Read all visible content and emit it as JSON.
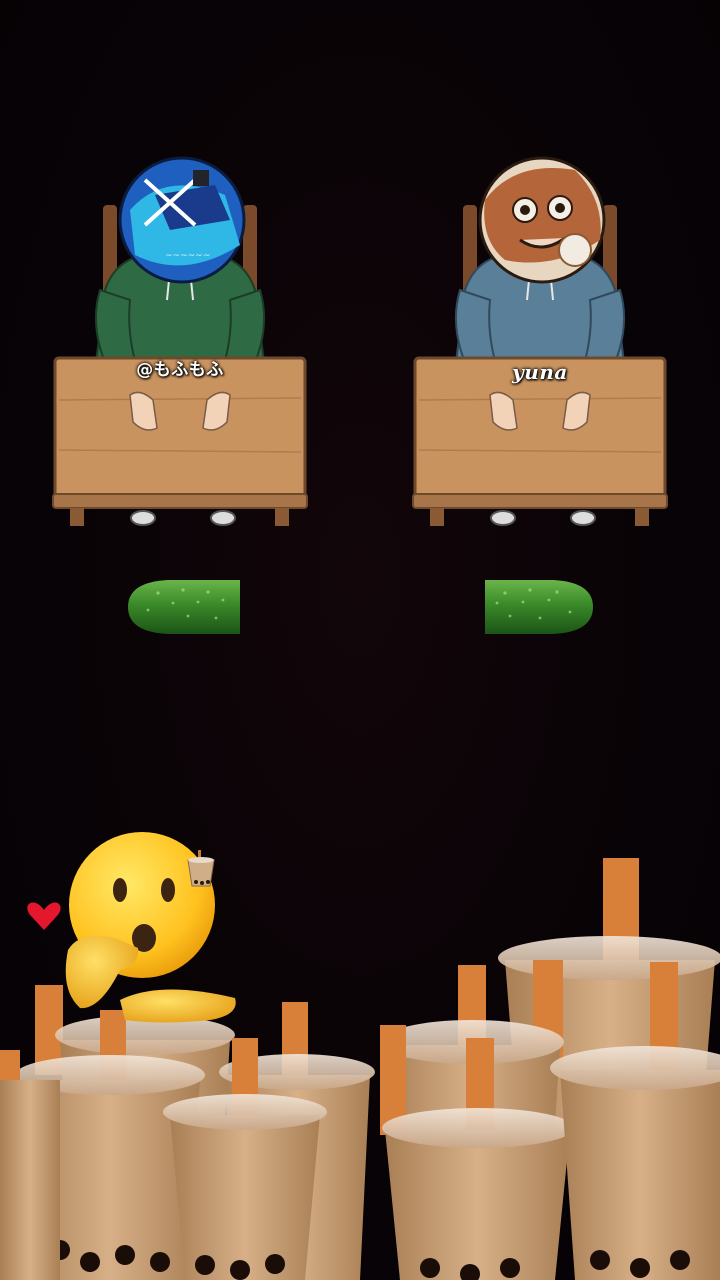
{
  "players": [
    {
      "name": "@もふもふ",
      "hoodie_color": "#2e6a44",
      "avatar": "blue-character-avatar"
    },
    {
      "name": "yuna",
      "hoodie_color": "#5a7f99",
      "avatar": "brown-character-avatar"
    }
  ],
  "cucumbers": [
    {
      "side": "left",
      "shown_fraction": 0.5
    },
    {
      "side": "right",
      "shown_fraction": 0.5
    }
  ],
  "decorations": {
    "reaction_emoji": "hushed-face-icon",
    "heart": "heart-icon",
    "drink": "bubble-tea-icon"
  },
  "colors": {
    "background": "#080306",
    "table": "#c9935f",
    "cucumber": "#3a8a2a",
    "tea": "#c9a074",
    "straw": "#d8803a"
  }
}
